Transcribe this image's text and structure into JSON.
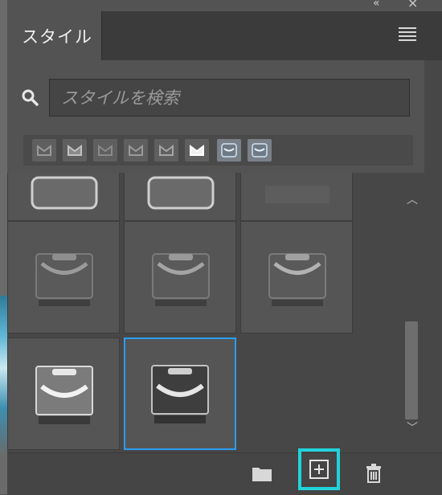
{
  "panel": {
    "tab_label": "スタイル",
    "search": {
      "placeholder": "スタイルを検索",
      "value": ""
    }
  },
  "icons": {
    "collapse": "double-chevron-icon",
    "close": "close-icon",
    "menu": "hamburger-menu-icon",
    "search": "search-icon",
    "new_group": "folder-icon",
    "new_style": "plus-square-icon",
    "delete": "trash-icon",
    "scroll_up": "chevron-up-icon",
    "scroll_down": "chevron-down-icon"
  },
  "colors": {
    "selection": "#2a9df4",
    "highlight": "#22d3dc"
  },
  "preset_count": 8,
  "selected_tile": 5
}
